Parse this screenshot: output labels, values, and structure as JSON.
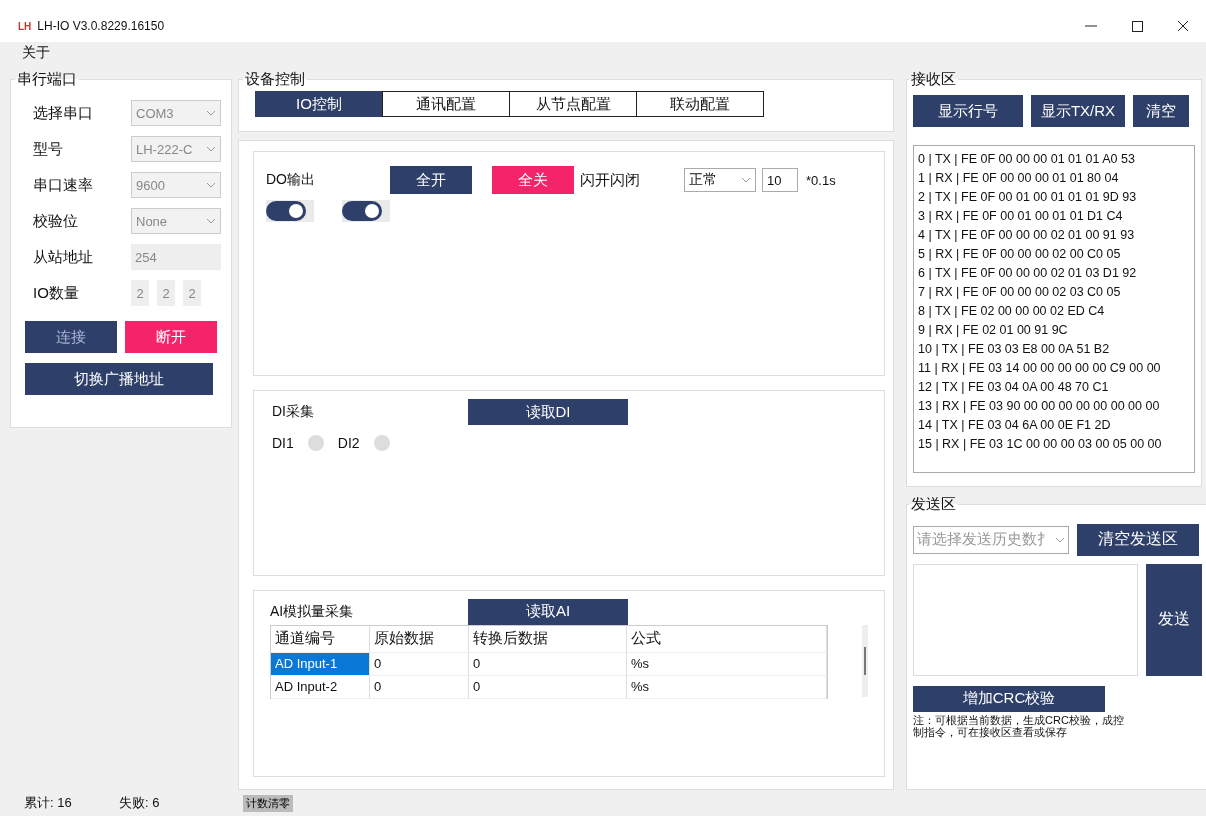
{
  "window": {
    "logo": "LH",
    "title": "LH-IO V3.0.8229.16150"
  },
  "menu": [
    "关于"
  ],
  "serial_port": {
    "title": "串行端口",
    "fields": [
      {
        "label": "选择串口",
        "kind": "select",
        "value": "COM3"
      },
      {
        "label": "型号",
        "kind": "select",
        "value": "LH-222-C"
      },
      {
        "label": "串口速率",
        "kind": "select",
        "value": "9600"
      },
      {
        "label": "校验位",
        "kind": "select",
        "value": "None"
      },
      {
        "label": "从站地址",
        "kind": "text",
        "value": "254"
      }
    ],
    "io_count": {
      "label": "IO数量",
      "values": [
        "2",
        "2",
        "2"
      ]
    },
    "buttons": [
      {
        "label": "连接",
        "kind": "primary",
        "disabled": true
      },
      {
        "label": "断开",
        "kind": "danger",
        "disabled": false
      }
    ],
    "broadcast_button": "切换广播地址"
  },
  "device_control": {
    "title": "设备控制",
    "tabs": [
      {
        "label": "IO控制",
        "selected": true
      },
      {
        "label": "通讯配置",
        "selected": false
      },
      {
        "label": "从节点配置",
        "selected": false
      },
      {
        "label": "联动配置",
        "selected": false
      }
    ],
    "do_output": {
      "title": "DO输出",
      "buttons": [
        {
          "label": "全开",
          "kind": "primary"
        },
        {
          "label": "全关",
          "kind": "danger"
        }
      ],
      "flash_label": "闪开闪闭",
      "mode": "正常",
      "interval": "10",
      "unit": "*0.1s",
      "switches": [
        {
          "on": true
        },
        {
          "on": true
        }
      ]
    },
    "di": {
      "title": "DI采集",
      "button": "读取DI",
      "inputs": [
        {
          "label": "DI1",
          "on": false
        },
        {
          "label": "DI2",
          "on": false
        }
      ]
    },
    "ai": {
      "title": "AI模拟量采集",
      "button": "读取AI",
      "columns": [
        "通道编号",
        "原始数据",
        "转换后数据",
        "公式"
      ],
      "rows": [
        {
          "cells": [
            "AD Input-1",
            "0",
            "0",
            "%s"
          ],
          "selected": true
        },
        {
          "cells": [
            "AD Input-2",
            "0",
            "0",
            "%s"
          ],
          "selected": false
        }
      ]
    }
  },
  "receive": {
    "title": "接收区",
    "buttons": [
      "显示行号",
      "显示TX/RX",
      "清空"
    ],
    "lines": [
      "0 | TX | FE 0F 00 00 00 01 01 01 A0 53",
      "1 | RX | FE 0F 00 00 00 01 01 80 04",
      "2 | TX | FE 0F 00 01 00 01 01 01 9D 93",
      "3 | RX | FE 0F 00 01 00 01 01 D1 C4",
      "4 | TX | FE 0F 00 00 00 02 01 00 91 93",
      "5 | RX | FE 0F 00 00 00 02 00 C0 05",
      "6 | TX | FE 0F 00 00 00 02 01 03 D1 92",
      "7 | RX | FE 0F 00 00 00 02 03 C0 05",
      "8 | TX | FE 02 00 00 00 02 ED C4",
      "9 | RX | FE 02 01 00 91 9C",
      "10 | TX | FE 03 03 E8 00 0A 51 B2",
      "11 | RX | FE 03 14 00 00 00 00 00 C9 00 00",
      "12 | TX | FE 03 04 0A 00 48 70 C1",
      "13 | RX | FE 03 90 00 00 00 00 00 00 00 00",
      "14 | TX | FE 03 04 6A 00 0E F1 2D",
      "15 | RX | FE 03 1C 00 00 00 03 00 05 00 00"
    ]
  },
  "send": {
    "title": "发送区",
    "history_placeholder": "请选择发送历史数扌",
    "clear_button": "清空发送区",
    "send_button": "发送",
    "crc_button": "增加CRC校验",
    "note": "注：可根据当前数据，生成CRC校验，成控制指令，可在接收区查看或保存"
  },
  "status_bar": {
    "total": "累计: 16",
    "failed": "失败: 6",
    "reset_button": "计数清零"
  }
}
